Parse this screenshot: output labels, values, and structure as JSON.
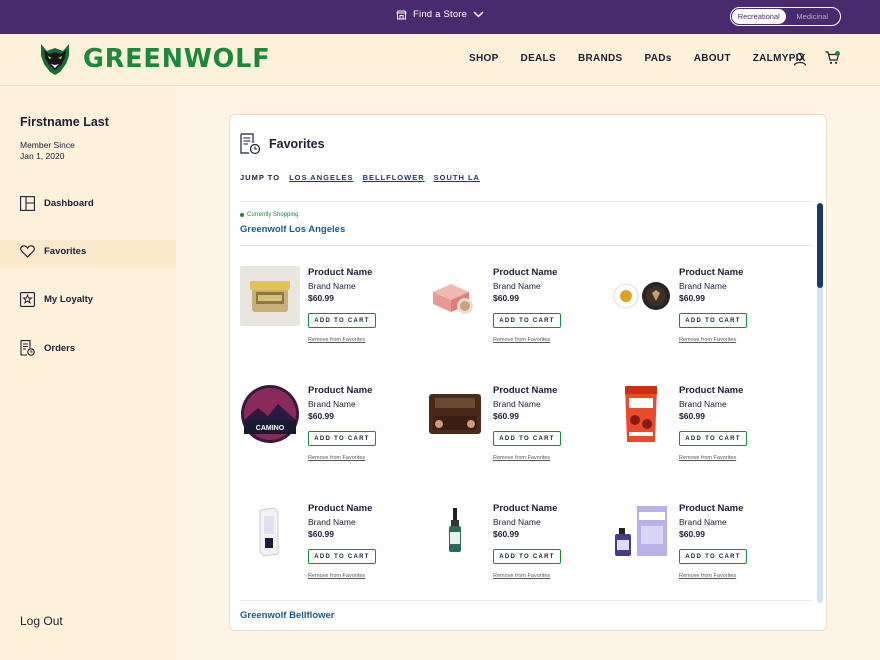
{
  "topbar": {
    "find_store": "Find a Store",
    "toggle": [
      "Recreational",
      "Medicinal"
    ],
    "toggle_active": "Recreational"
  },
  "header": {
    "logo_text": "GREENWOLF",
    "nav": [
      "SHOP",
      "DEALS",
      "BRANDS",
      "PADs",
      "ABOUT",
      "ZALMYPIX"
    ]
  },
  "sidebar": {
    "name": "Firstname Last",
    "member_since_label": "Member Since",
    "member_since_date": "Jan 1, 2020",
    "items": [
      "Dashboard",
      "Favorites",
      "My Loyalty",
      "Orders"
    ],
    "active": "Favorites",
    "logout": "Log Out"
  },
  "favorites": {
    "title": "Favorites",
    "jump_label": "JUMP TO",
    "jump_links": [
      "LOS ANGELES",
      "BELLFLOWER",
      "SOUTH LA"
    ],
    "currently_shopping": "Currently Shopping",
    "store_1": "Greenwolf Los Angeles",
    "store_2": "Greenwolf Bellflower",
    "add_to_cart": "ADD TO CART",
    "remove": "Remove from Favorites",
    "products": [
      {
        "name": "Product Name",
        "brand": "Brand Name",
        "price": "$60.99",
        "image": "jar-icon"
      },
      {
        "name": "Product Name",
        "brand": "Brand Name",
        "price": "$60.99",
        "image": "gift-box-icon"
      },
      {
        "name": "Product Name",
        "brand": "Brand Name",
        "price": "$60.99",
        "image": "concentrate-icon"
      },
      {
        "name": "Product Name",
        "brand": "Brand Name",
        "price": "$60.99",
        "image": "camino-tin-icon"
      },
      {
        "name": "Product Name",
        "brand": "Brand Name",
        "price": "$60.99",
        "image": "pouch-icon"
      },
      {
        "name": "Product Name",
        "brand": "Brand Name",
        "price": "$60.99",
        "image": "bag-icon"
      },
      {
        "name": "Product Name",
        "brand": "Brand Name",
        "price": "$60.99",
        "image": "vape-box-icon"
      },
      {
        "name": "Product Name",
        "brand": "Brand Name",
        "price": "$60.99",
        "image": "tincture-icon"
      },
      {
        "name": "Product Name",
        "brand": "Brand Name",
        "price": "$60.99",
        "image": "cbd-box-icon"
      }
    ]
  },
  "colors": {
    "topbar": "#4a2a6e",
    "brand_green": "#1a8a3a",
    "background": "#fdf1da",
    "link_blue": "#1a5a8a"
  }
}
